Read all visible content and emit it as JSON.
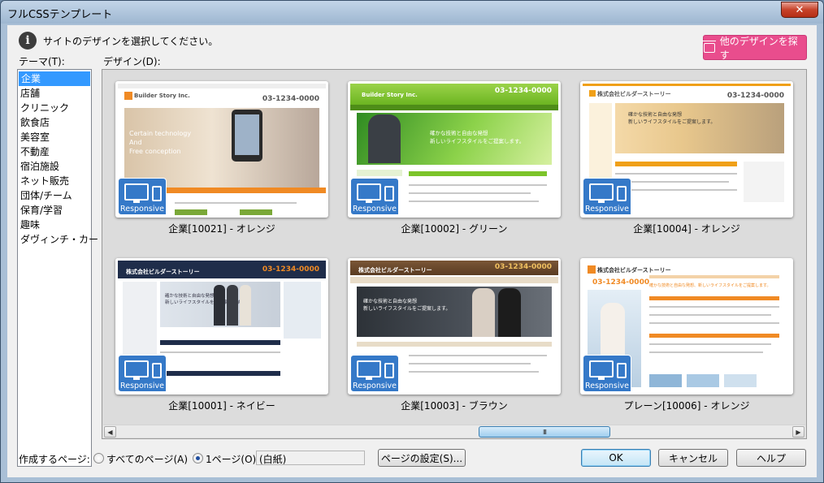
{
  "window": {
    "title": "フルCSSテンプレート",
    "close_label": "✕"
  },
  "info": {
    "icon": "info-icon",
    "text": "サイトのデザインを選択してください。"
  },
  "other_design_button": {
    "label": "他のデザインを探す",
    "icon": "store-icon",
    "color": "#e94d8d"
  },
  "theme": {
    "label": "テーマ(T):",
    "items": [
      "企業",
      "店舗",
      "クリニック",
      "飲食店",
      "美容室",
      "不動産",
      "宿泊施設",
      "ネット販売",
      "団体/チーム",
      "保育/学習",
      "趣味",
      "ダヴィンチ・カート"
    ],
    "selected_index": 0
  },
  "design": {
    "label": "デザイン(D):",
    "badge_label": "Responsive",
    "cards": [
      {
        "caption": "企業[10021] - オレンジ",
        "logo": "Builder Story Inc.",
        "tel": "03-1234-0000",
        "hero_text": "Certain technology\nAnd\nFree conception",
        "accent": "#f08a24"
      },
      {
        "caption": "企業[10002] - グリーン",
        "logo": "Builder Story Inc.",
        "tel": "03-1234-0000",
        "hero_text": "確かな技術と自由な発想\n新しいライフスタイルをご提案します。",
        "accent": "#7cc42a"
      },
      {
        "caption": "企業[10004] - オレンジ",
        "logo": "株式会社ビルダーストーリー",
        "tel": "03-1234-0000",
        "hero_text": "確かな技術と自由な発想\n新しいライフスタイルをご提案します。",
        "accent": "#f0a018"
      },
      {
        "caption": "企業[10001] - ネイビー",
        "logo": "株式会社ビルダーストーリー",
        "tel": "03-1234-0000",
        "hero_text": "確かな技術と自由な発想\n新しいライフスタイルをご提案します。",
        "accent": "#1f2d4a"
      },
      {
        "caption": "企業[10003] - ブラウン",
        "logo": "株式会社ビルダーストーリー",
        "tel": "03-1234-0000",
        "hero_text": "確かな技術と自由な発想\n新しいライフスタイルをご提案します。",
        "accent": "#6b4a2b"
      },
      {
        "caption": "プレーン[10006] - オレンジ",
        "logo": "株式会社ビルダーストーリー",
        "tel": "03-1234-0000",
        "hero_text": "確かな技術と自由な発想、新しいライフスタイルをご提案します。",
        "accent": "#f08a24"
      }
    ]
  },
  "scrollbar": {
    "thumb_grip": "III",
    "left_arrow": "◀",
    "right_arrow": "▶"
  },
  "footer": {
    "create_pages_label": "作成するページ:",
    "radio_all": "すべてのページ(A)",
    "radio_one": "1ページ(O)",
    "selected_radio": "radio_one",
    "page_field_value": "(白紙)",
    "page_settings_button": "ページの設定(S)...",
    "ok_button": "OK",
    "cancel_button": "キャンセル",
    "help_button": "ヘルプ"
  }
}
